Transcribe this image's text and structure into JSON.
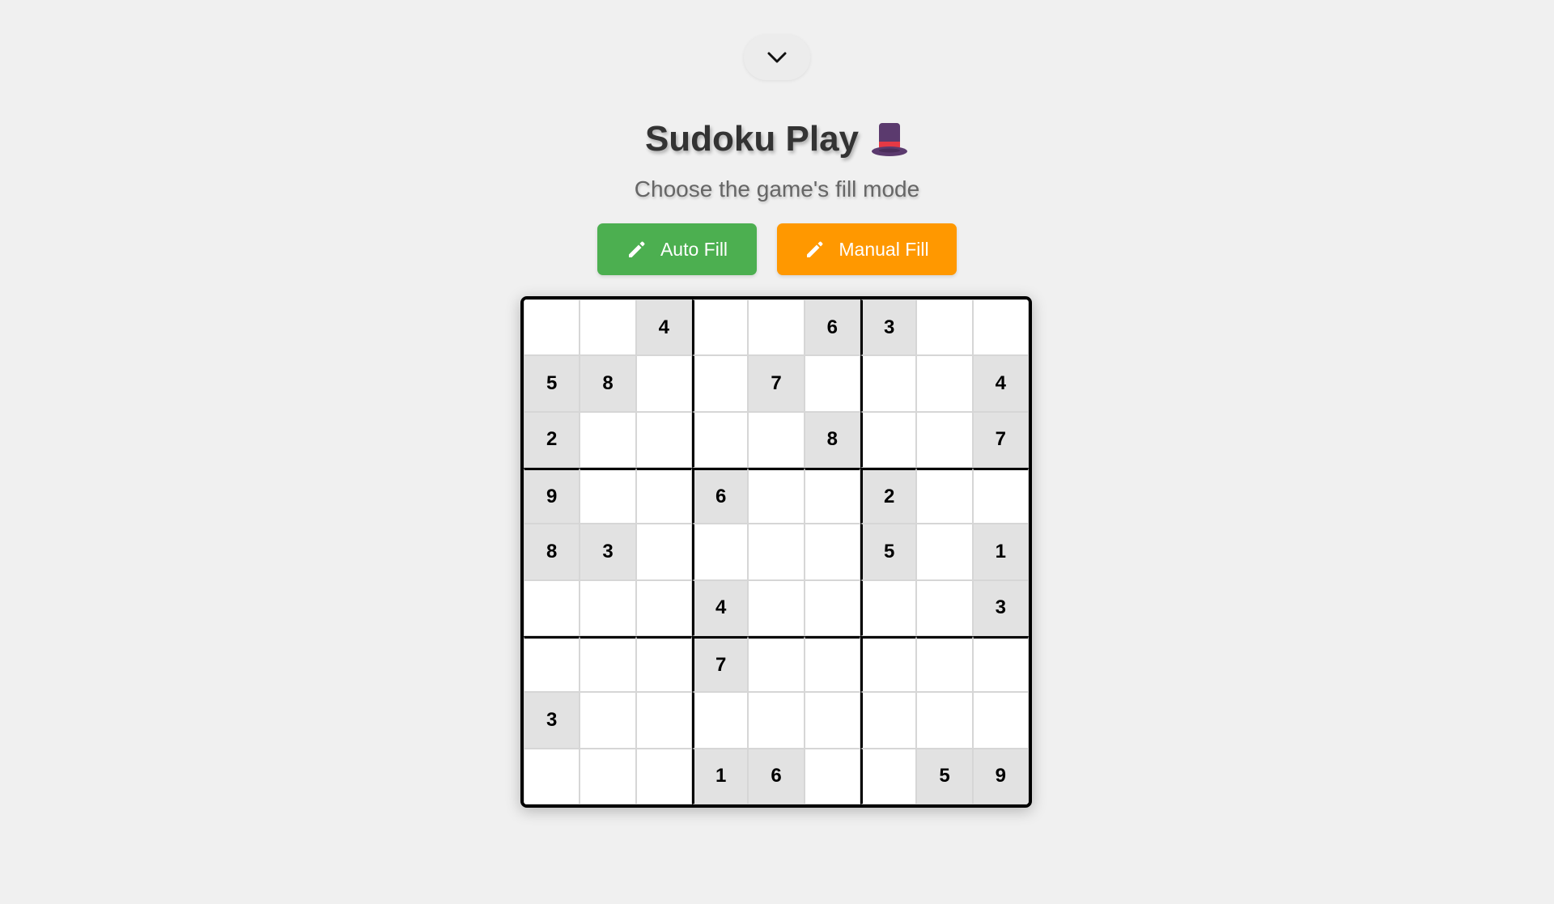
{
  "header": {
    "toggle_icon": "chevron-down-icon",
    "title": "Sudoku Play",
    "title_icon": "top-hat-icon",
    "subtitle": "Choose the game's fill mode"
  },
  "buttons": {
    "auto_fill_label": "Auto Fill",
    "manual_fill_label": "Manual Fill",
    "icon": "pencil-icon"
  },
  "colors": {
    "auto_fill": "#4caf50",
    "manual_fill": "#ff9800",
    "given_cell": "#e2e2e2",
    "background": "#f0f0f0"
  },
  "board": {
    "rows": [
      [
        "",
        "",
        "4",
        "",
        "",
        "6",
        "3",
        "",
        ""
      ],
      [
        "5",
        "8",
        "",
        "",
        "7",
        "",
        "",
        "",
        "4"
      ],
      [
        "2",
        "",
        "",
        "",
        "",
        "8",
        "",
        "",
        "7"
      ],
      [
        "9",
        "",
        "",
        "6",
        "",
        "",
        "2",
        "",
        ""
      ],
      [
        "8",
        "3",
        "",
        "",
        "",
        "",
        "5",
        "",
        "1"
      ],
      [
        "",
        "",
        "",
        "4",
        "",
        "",
        "",
        "",
        "3"
      ],
      [
        "",
        "",
        "",
        "7",
        "",
        "",
        "",
        "",
        ""
      ],
      [
        "3",
        "",
        "",
        "",
        "",
        "",
        "",
        "",
        ""
      ],
      [
        "",
        "",
        "",
        "1",
        "6",
        "",
        "",
        "5",
        "9"
      ]
    ]
  }
}
